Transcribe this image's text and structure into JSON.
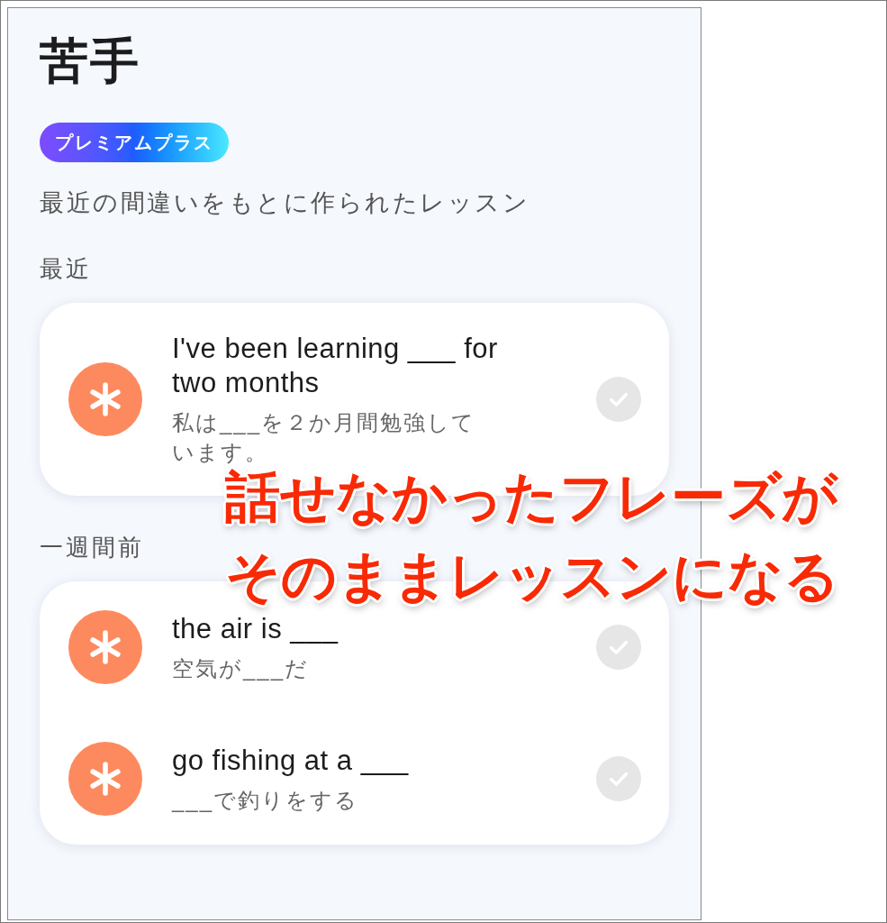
{
  "screen": {
    "title": "苦手",
    "badge": "プレミアムプラス",
    "description": "最近の間違いをもとに作られたレッスン",
    "sections": [
      {
        "heading": "最近",
        "items": [
          {
            "phrase": "I've been learning ___ for two months",
            "translation": "私は___を２か月間勉強しています。",
            "checked": false
          }
        ]
      },
      {
        "heading": "一週間前",
        "items": [
          {
            "phrase": "the air is ___",
            "translation": "空気が___だ",
            "checked": false
          },
          {
            "phrase": "go fishing at a ___",
            "translation": "___で釣りをする",
            "checked": false
          }
        ]
      }
    ]
  },
  "caption": {
    "lines": [
      "話せなかったフレーズが",
      "そのままレッスンになる"
    ]
  }
}
